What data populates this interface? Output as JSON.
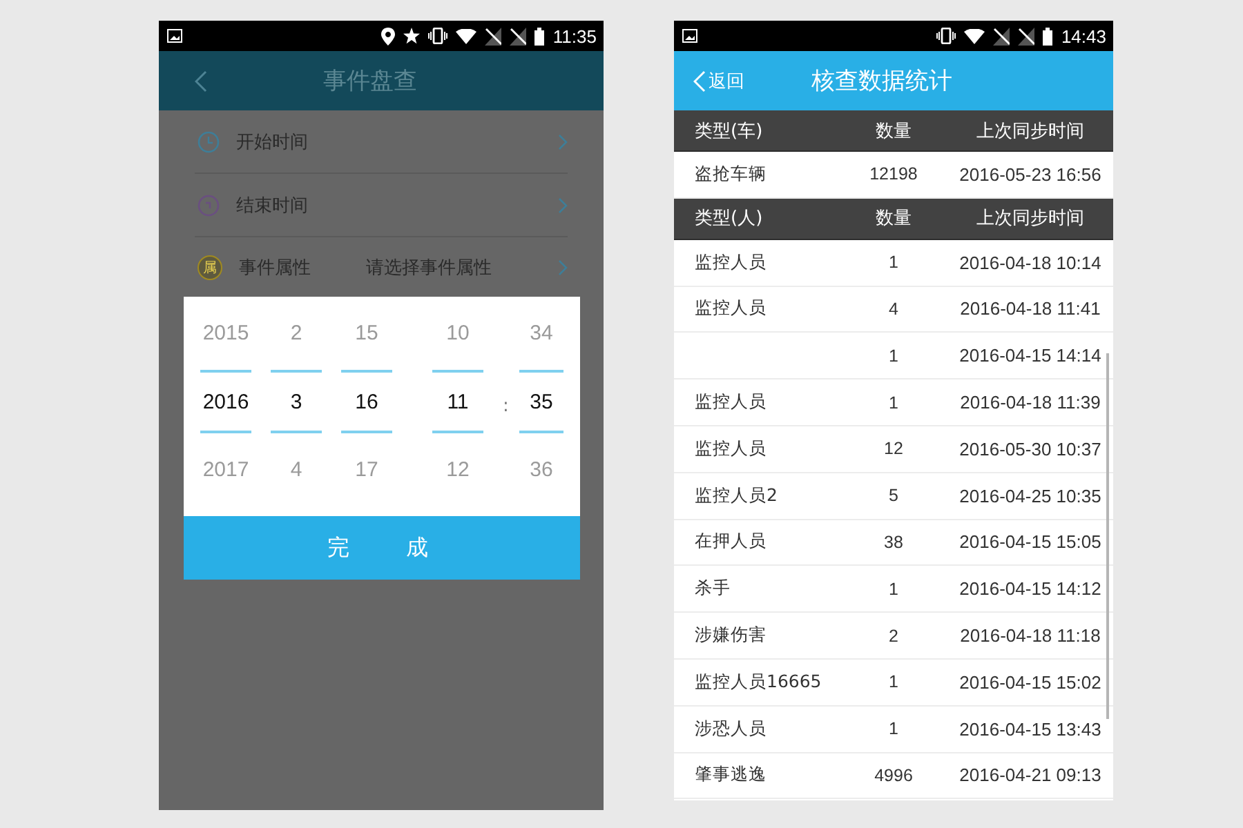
{
  "left_phone": {
    "status_bar": {
      "time": "11:35"
    },
    "header": {
      "title": "事件盘查"
    },
    "form_rows": [
      {
        "kind": "clock",
        "label": "开始时间"
      },
      {
        "kind": "clock-alt",
        "label": "结束时间"
      },
      {
        "kind": "badge",
        "icon_text": "属",
        "label": "事件属性",
        "placeholder": "请选择事件属性"
      }
    ],
    "picker": {
      "columns": [
        {
          "above": "2015",
          "current": "2016",
          "below": "2017"
        },
        {
          "above": "2",
          "current": "3",
          "below": "4"
        },
        {
          "above": "15",
          "current": "16",
          "below": "17"
        },
        {
          "above": "10",
          "current": "11",
          "below": "12",
          "separator_after": ":"
        },
        {
          "above": "34",
          "current": "35",
          "below": "36"
        }
      ],
      "done_button": "完 成"
    }
  },
  "right_phone": {
    "status_bar": {
      "time": "14:43"
    },
    "header": {
      "back": "返回",
      "title": "核查数据统计"
    },
    "vehicle_table": {
      "columns": [
        "类型(车)",
        "数量",
        "上次同步时间"
      ],
      "rows": [
        {
          "type": "盗抢车辆",
          "count": "12198",
          "time": "2016-05-23 16:56"
        }
      ]
    },
    "person_table": {
      "columns": [
        "类型(人)",
        "数量",
        "上次同步时间"
      ],
      "rows": [
        {
          "type": "监控人员",
          "count": "1",
          "time": "2016-04-18 10:14"
        },
        {
          "type": "监控人员",
          "count": "4",
          "time": "2016-04-18 11:41"
        },
        {
          "count": "1",
          "time": "2016-04-15 14:14"
        },
        {
          "type": "监控人员",
          "count": "1",
          "time": "2016-04-18 11:39"
        },
        {
          "type": "监控人员",
          "count": "12",
          "time": "2016-05-30 10:37"
        },
        {
          "type": "监控人员2",
          "count": "5",
          "time": "2016-04-25 10:35"
        },
        {
          "type": "在押人员",
          "count": "38",
          "time": "2016-04-15 15:05"
        },
        {
          "type": "杀手",
          "count": "1",
          "time": "2016-04-15 14:12"
        },
        {
          "type": "涉嫌伤害",
          "count": "2",
          "time": "2016-04-18 11:18"
        },
        {
          "type": "监控人员16665",
          "count": "1",
          "time": "2016-04-15 15:02"
        },
        {
          "type": "涉恐人员",
          "count": "1",
          "time": "2016-04-15 13:43"
        },
        {
          "type": "肇事逃逸",
          "count": "4996",
          "time": "2016-04-21 09:13"
        }
      ]
    }
  }
}
